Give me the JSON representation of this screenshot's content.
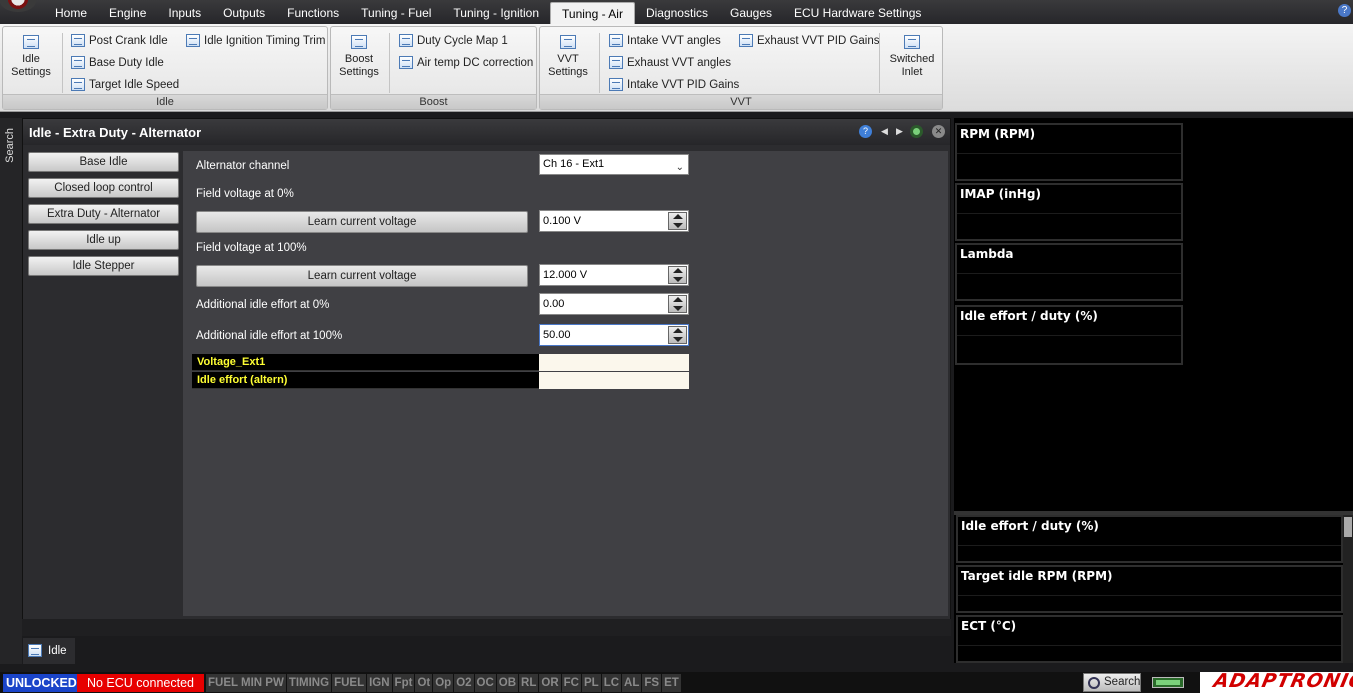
{
  "menu": {
    "tabs": [
      "Home",
      "Engine",
      "Inputs",
      "Outputs",
      "Functions",
      "Tuning - Fuel",
      "Tuning - Ignition",
      "Tuning - Air",
      "Diagnostics",
      "Gauges",
      "ECU Hardware Settings"
    ],
    "active_tab": "Tuning - Air"
  },
  "ribbon": {
    "idle": {
      "title": "Idle",
      "big_label": "Idle Settings",
      "items": [
        "Post Crank Idle",
        "Base Duty Idle",
        "Target Idle Speed",
        "Idle Ignition Timing Trim"
      ]
    },
    "boost": {
      "title": "Boost",
      "big_label": "Boost Settings",
      "items": [
        "Duty Cycle Map 1",
        "Air temp DC correction"
      ]
    },
    "vvt": {
      "title": "VVT",
      "big_label": "VVT Settings",
      "items": [
        "Intake VVT angles",
        "Exhaust VVT angles",
        "Intake VVT PID Gains",
        "Exhaust VVT PID Gains"
      ],
      "switched_label": "Switched Inlet"
    }
  },
  "sidebar": {
    "search_label": "Search"
  },
  "panel": {
    "title": "Idle - Extra Duty - Alternator",
    "nav": [
      "Base Idle",
      "Closed loop control",
      "Extra Duty - Alternator",
      "Idle up",
      "Idle Stepper"
    ],
    "form": {
      "channel_label": "Alternator channel",
      "channel_value": "Ch 16 - Ext1",
      "field0_label": "Field voltage at 0%",
      "learn_label": "Learn current voltage",
      "field0_value": "0.100 V",
      "field100_label": "Field voltage at 100%",
      "field100_value": "12.000 V",
      "effort0_label": "Additional idle effort at 0%",
      "effort0_value": "0.00",
      "effort100_label": "Additional idle effort at 100%",
      "effort100_value": "50.00"
    },
    "outputs": [
      "Voltage_Ext1",
      "Idle effort (altern)"
    ]
  },
  "bottom_tab": {
    "label": "Idle"
  },
  "gauges": {
    "top": [
      "RPM (RPM)",
      "IMAP  (inHg)",
      "Lambda",
      "Idle effort / duty (%)"
    ],
    "bottom": [
      "Idle effort / duty (%)",
      "Target idle RPM (RPM)",
      "ECT (°C)"
    ]
  },
  "status": {
    "unlocked": "UNLOCKED",
    "ecu": "No ECU connected",
    "flags": [
      "FUEL MIN PW",
      "TIMING",
      "FUEL",
      "IGN",
      "Fpt",
      "Ot",
      "Op",
      "O2",
      "OC",
      "OB",
      "RL",
      "OR",
      "FC",
      "PL",
      "LC",
      "AL",
      "FS",
      "ET"
    ],
    "search_label": "Search",
    "brand": "ADAPTRONIC"
  },
  "colors": {
    "accent": "#1a44c9",
    "error": "#e70000",
    "output_name": "#ffff33"
  }
}
